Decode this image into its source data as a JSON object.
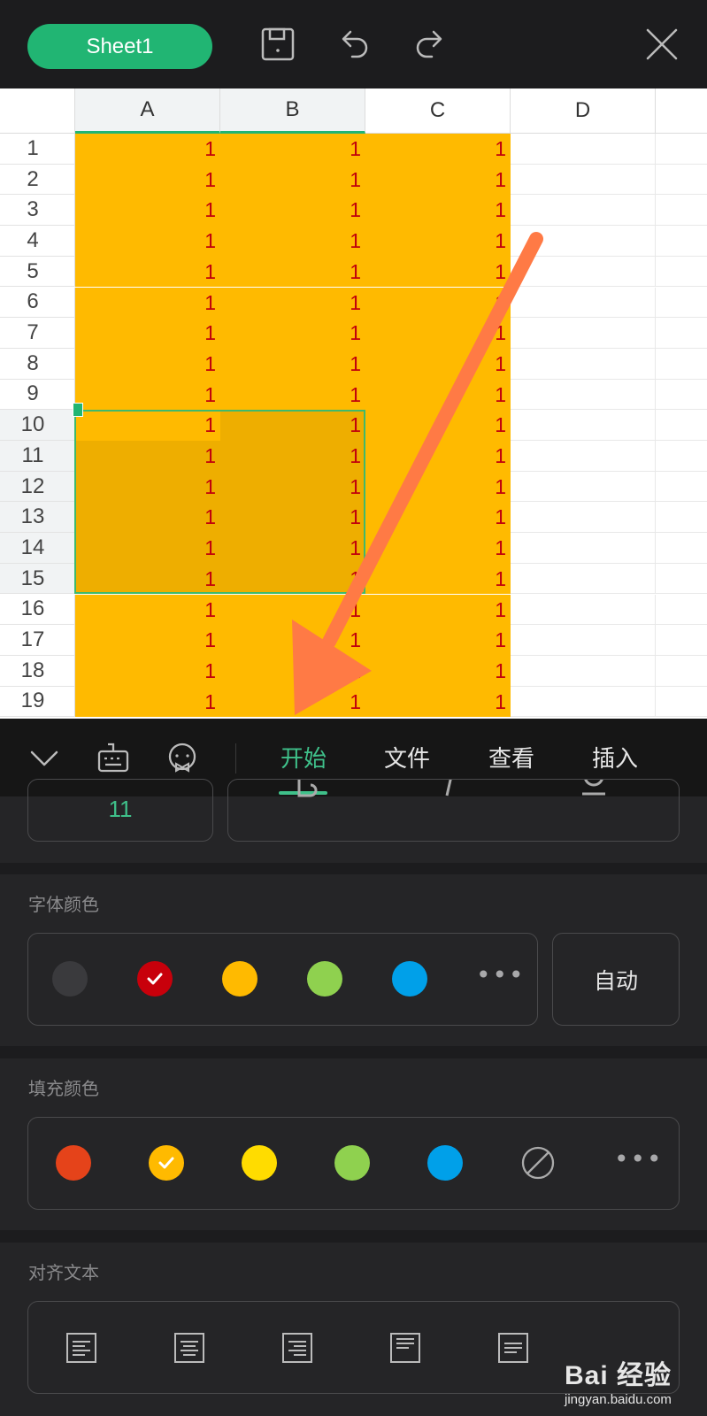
{
  "app": {
    "sheet_tab": "Sheet1",
    "close_label": "×"
  },
  "grid": {
    "columns": [
      "A",
      "B",
      "C",
      "D"
    ],
    "selected_columns": [
      "A",
      "B"
    ],
    "rows": [
      "1",
      "2",
      "3",
      "4",
      "5",
      "6",
      "7",
      "8",
      "9",
      "10",
      "11",
      "12",
      "13",
      "14",
      "15",
      "16",
      "17",
      "18",
      "19"
    ],
    "selected_rows": [
      "10",
      "11",
      "12",
      "13",
      "14",
      "15"
    ],
    "cell_value": "1",
    "fill_color": "#ffba00",
    "font_color": "#c0000c",
    "selection_border_color": "#3fb96b",
    "annotation_arrow_color": "#ff7a45"
  },
  "ribbon": {
    "tabs": [
      "开始",
      "文件",
      "查看",
      "插入"
    ],
    "active_tab": "开始",
    "accent": "#3fc08a"
  },
  "panel": {
    "font_size_value": "11",
    "font_color": {
      "title": "字体颜色",
      "swatches": [
        "#3a3a3d",
        "#c8000b",
        "#ffba00",
        "#8fd14f",
        "#00a0e9"
      ],
      "selected": "#c8000b",
      "more": "•••",
      "auto_label": "自动"
    },
    "fill_color": {
      "title": "填充颜色",
      "swatches": [
        "#e5431a",
        "#ffba00",
        "#ffdc00",
        "#8fd14f",
        "#00a0e9"
      ],
      "selected": "#ffba00",
      "no_fill": "none",
      "more": "•••"
    },
    "align_text": {
      "title": "对齐文本",
      "options": [
        "left-align-icon",
        "center-align-icon",
        "right-align-icon",
        "top-align-icon",
        "middle-align-icon"
      ]
    }
  },
  "watermark": {
    "brand": "Bai 经验",
    "url": "jingyan.baidu.com"
  }
}
